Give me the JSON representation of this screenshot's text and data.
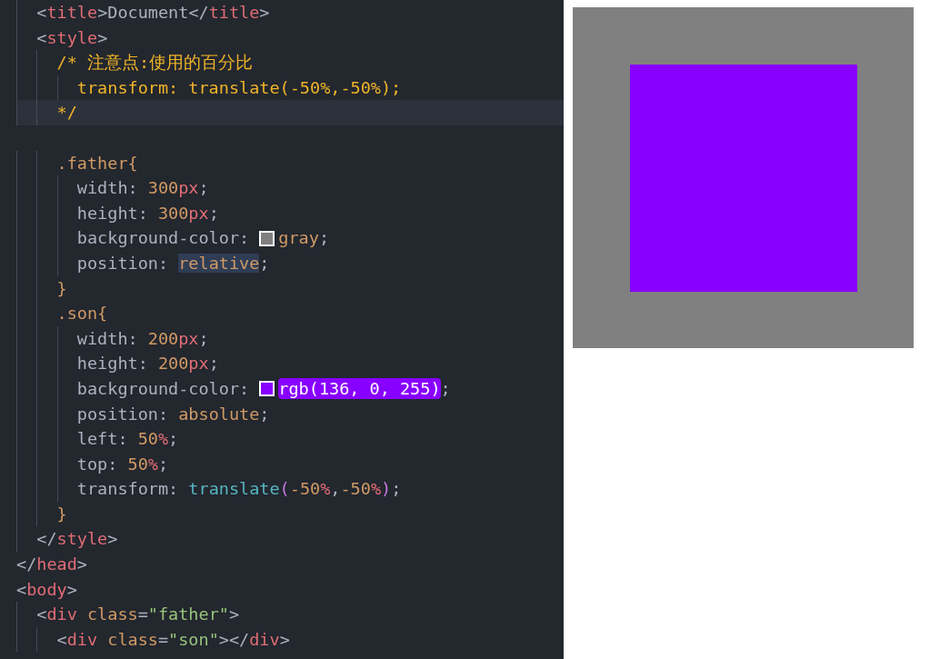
{
  "editor": {
    "lines": [
      {
        "selected": false,
        "tokens": [
          {
            "text": "  <",
            "kind": "punct"
          },
          {
            "text": "title",
            "kind": "tag"
          },
          {
            "text": ">",
            "kind": "punct"
          },
          {
            "text": "Document",
            "kind": "plain"
          },
          {
            "text": "</",
            "kind": "punct"
          },
          {
            "text": "title",
            "kind": "tag"
          },
          {
            "text": ">",
            "kind": "punct"
          }
        ]
      },
      {
        "selected": false,
        "tokens": [
          {
            "text": "  <",
            "kind": "punct"
          },
          {
            "text": "style",
            "kind": "tag"
          },
          {
            "text": ">",
            "kind": "punct"
          }
        ]
      },
      {
        "selected": false,
        "tokens": [
          {
            "text": "    /* 注意点:使用的百分比",
            "kind": "comment"
          }
        ]
      },
      {
        "selected": false,
        "tokens": [
          {
            "text": "      transform: translate(-50%,-50%);",
            "kind": "comment"
          }
        ]
      },
      {
        "selected": true,
        "tokens": [
          {
            "text": "    */",
            "kind": "comment"
          }
        ]
      },
      {
        "selected": false
      },
      {
        "selected": false,
        "tokens": [
          {
            "text": "    .father{",
            "kind": "selector"
          }
        ]
      },
      {
        "selected": false,
        "tokens": [
          {
            "text": "      width",
            "kind": "property"
          },
          {
            "text": ": ",
            "kind": "punct"
          },
          {
            "text": "300",
            "kind": "number"
          },
          {
            "text": "px",
            "kind": "unit"
          },
          {
            "text": ";",
            "kind": "punct"
          }
        ]
      },
      {
        "selected": false,
        "tokens": [
          {
            "text": "      height",
            "kind": "property"
          },
          {
            "text": ": ",
            "kind": "punct"
          },
          {
            "text": "300",
            "kind": "number"
          },
          {
            "text": "px",
            "kind": "unit"
          },
          {
            "text": ";",
            "kind": "punct"
          }
        ]
      },
      {
        "selected": false,
        "tokens": [
          {
            "text": "      background-color",
            "kind": "property"
          },
          {
            "text": ": ",
            "kind": "punct"
          },
          {
            "kind": "swatch",
            "color": "#808080"
          },
          {
            "text": "gray",
            "kind": "value"
          },
          {
            "text": ";",
            "kind": "punct"
          }
        ]
      },
      {
        "selected": false,
        "tokens": [
          {
            "text": "      position",
            "kind": "property"
          },
          {
            "text": ": ",
            "kind": "punct"
          },
          {
            "text": "relative",
            "kind": "value",
            "highlighted": true
          },
          {
            "text": ";",
            "kind": "punct"
          }
        ]
      },
      {
        "selected": false,
        "tokens": [
          {
            "text": "    }",
            "kind": "selector"
          }
        ]
      },
      {
        "selected": false,
        "tokens": [
          {
            "text": "    .son{",
            "kind": "selector"
          }
        ]
      },
      {
        "selected": false,
        "tokens": [
          {
            "text": "      width",
            "kind": "property"
          },
          {
            "text": ": ",
            "kind": "punct"
          },
          {
            "text": "200",
            "kind": "number"
          },
          {
            "text": "px",
            "kind": "unit"
          },
          {
            "text": ";",
            "kind": "punct"
          }
        ]
      },
      {
        "selected": false,
        "tokens": [
          {
            "text": "      height",
            "kind": "property"
          },
          {
            "text": ": ",
            "kind": "punct"
          },
          {
            "text": "200",
            "kind": "number"
          },
          {
            "text": "px",
            "kind": "unit"
          },
          {
            "text": ";",
            "kind": "punct"
          }
        ]
      },
      {
        "selected": false,
        "tokens": [
          {
            "text": "      background-color",
            "kind": "property"
          },
          {
            "text": ": ",
            "kind": "punct"
          },
          {
            "kind": "swatch",
            "color": "#8800ff"
          },
          {
            "text": "rgb(136, 0, 255)",
            "kind": "color-value",
            "color": "#8800ff"
          },
          {
            "text": ";",
            "kind": "punct"
          }
        ]
      },
      {
        "selected": false,
        "tokens": [
          {
            "text": "      position",
            "kind": "property"
          },
          {
            "text": ": ",
            "kind": "punct"
          },
          {
            "text": "absolute",
            "kind": "value"
          },
          {
            "text": ";",
            "kind": "punct"
          }
        ]
      },
      {
        "selected": false,
        "tokens": [
          {
            "text": "      left",
            "kind": "property"
          },
          {
            "text": ": ",
            "kind": "punct"
          },
          {
            "text": "50",
            "kind": "number"
          },
          {
            "text": "%",
            "kind": "unit"
          },
          {
            "text": ";",
            "kind": "punct"
          }
        ]
      },
      {
        "selected": false,
        "tokens": [
          {
            "text": "      top",
            "kind": "property"
          },
          {
            "text": ": ",
            "kind": "punct"
          },
          {
            "text": "50",
            "kind": "number"
          },
          {
            "text": "%",
            "kind": "unit"
          },
          {
            "text": ";",
            "kind": "punct"
          }
        ]
      },
      {
        "selected": false,
        "tokens": [
          {
            "text": "      transform",
            "kind": "property"
          },
          {
            "text": ": ",
            "kind": "punct"
          },
          {
            "text": "translate",
            "kind": "function"
          },
          {
            "text": "(",
            "kind": "paren"
          },
          {
            "text": "-50",
            "kind": "number"
          },
          {
            "text": "%",
            "kind": "unit"
          },
          {
            "text": ",",
            "kind": "punct"
          },
          {
            "text": "-50",
            "kind": "number"
          },
          {
            "text": "%",
            "kind": "unit"
          },
          {
            "text": ")",
            "kind": "paren"
          },
          {
            "text": ";",
            "kind": "punct"
          }
        ]
      },
      {
        "selected": false,
        "tokens": [
          {
            "text": "    }",
            "kind": "selector"
          }
        ]
      },
      {
        "selected": false,
        "tokens": [
          {
            "text": "  </",
            "kind": "punct"
          },
          {
            "text": "style",
            "kind": "tag"
          },
          {
            "text": ">",
            "kind": "punct"
          }
        ]
      },
      {
        "selected": false,
        "tokens": [
          {
            "text": "</",
            "kind": "punct"
          },
          {
            "text": "head",
            "kind": "tag"
          },
          {
            "text": ">",
            "kind": "punct"
          }
        ]
      },
      {
        "selected": false,
        "tokens": [
          {
            "text": "<",
            "kind": "punct"
          },
          {
            "text": "body",
            "kind": "tag"
          },
          {
            "text": ">",
            "kind": "punct"
          }
        ]
      },
      {
        "selected": false,
        "tokens": [
          {
            "text": "  <",
            "kind": "punct"
          },
          {
            "text": "div",
            "kind": "tag"
          },
          {
            "text": " class",
            "kind": "attr"
          },
          {
            "text": "=",
            "kind": "punct"
          },
          {
            "text": "\"father\"",
            "kind": "string"
          },
          {
            "text": ">",
            "kind": "punct"
          }
        ]
      },
      {
        "selected": false,
        "tokens": [
          {
            "text": "    <",
            "kind": "punct"
          },
          {
            "text": "div",
            "kind": "tag"
          },
          {
            "text": " class",
            "kind": "attr"
          },
          {
            "text": "=",
            "kind": "punct"
          },
          {
            "text": "\"son\"",
            "kind": "string"
          },
          {
            "text": "></",
            "kind": "punct"
          },
          {
            "text": "div",
            "kind": "tag"
          },
          {
            "text": ">",
            "kind": "punct"
          }
        ]
      }
    ]
  }
}
